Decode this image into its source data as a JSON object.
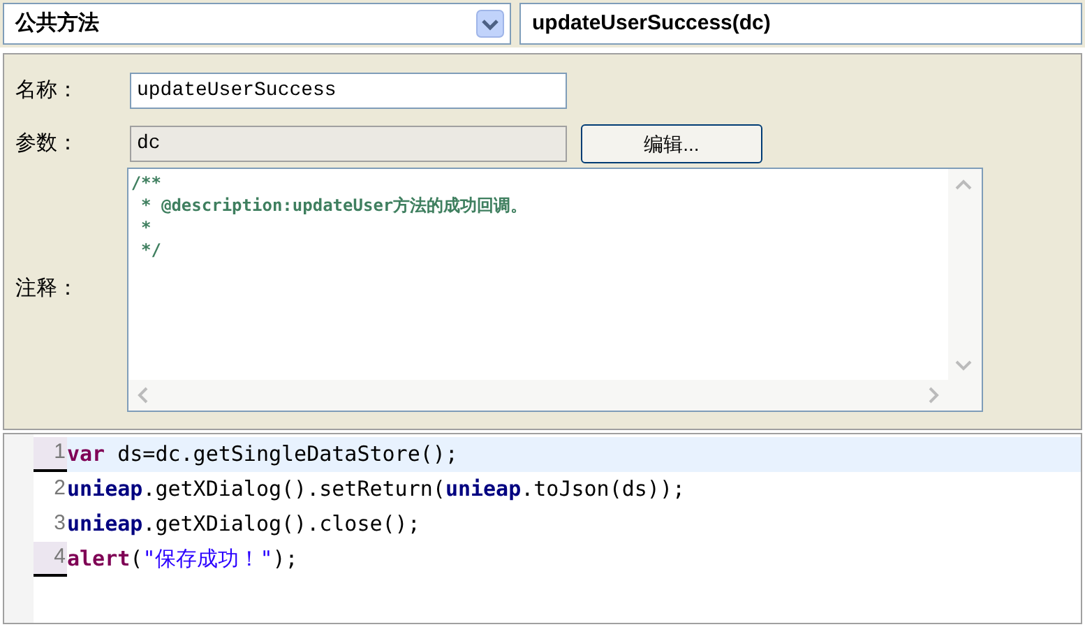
{
  "method_type": {
    "value": "公共方法"
  },
  "method_signature": {
    "value": "updateUserSuccess(dc)"
  },
  "form": {
    "name_label": "名称：",
    "name_value": "updateUserSuccess",
    "params_label": "参数：",
    "params_value": "dc",
    "edit_button": "编辑...",
    "comment_label": "注释：",
    "comment_lines": [
      "/**",
      " * @description:updateUser方法的成功回调。",
      " *",
      " */"
    ]
  },
  "code_lines": [
    {
      "number": "1",
      "current": true,
      "marked": true,
      "tokens": [
        {
          "kind": "keyword",
          "text": "var"
        },
        {
          "kind": "plain",
          "text": " ds=dc.getSingleDataStore();"
        }
      ]
    },
    {
      "number": "2",
      "current": false,
      "marked": false,
      "tokens": [
        {
          "kind": "object",
          "text": "unieap"
        },
        {
          "kind": "plain",
          "text": ".getXDialog().setReturn("
        },
        {
          "kind": "object",
          "text": "unieap"
        },
        {
          "kind": "plain",
          "text": ".toJson(ds));"
        }
      ]
    },
    {
      "number": "3",
      "current": false,
      "marked": false,
      "tokens": [
        {
          "kind": "object",
          "text": "unieap"
        },
        {
          "kind": "plain",
          "text": ".getXDialog().close();"
        }
      ]
    },
    {
      "number": "4",
      "current": false,
      "marked": true,
      "tokens": [
        {
          "kind": "keyword",
          "text": "alert"
        },
        {
          "kind": "plain",
          "text": "("
        },
        {
          "kind": "string",
          "text": "\"保存成功！\""
        },
        {
          "kind": "plain",
          "text": ");"
        }
      ]
    }
  ]
}
